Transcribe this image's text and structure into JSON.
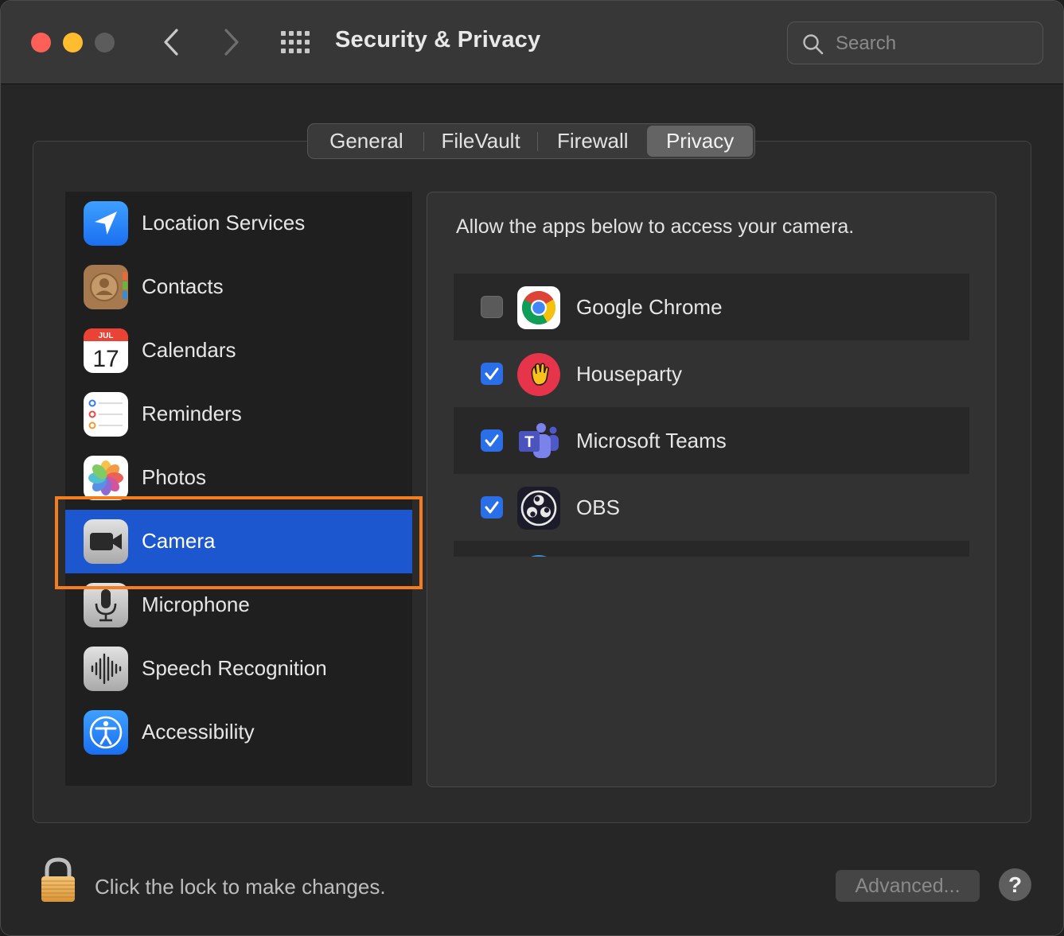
{
  "window": {
    "title": "Security & Privacy"
  },
  "search": {
    "placeholder": "Search"
  },
  "tabs": [
    {
      "label": "General"
    },
    {
      "label": "FileVault"
    },
    {
      "label": "Firewall"
    },
    {
      "label": "Privacy",
      "selected": true
    }
  ],
  "sidebar": {
    "items": [
      {
        "label": "Location Services",
        "icon": "location-arrow-icon"
      },
      {
        "label": "Contacts",
        "icon": "contacts-icon"
      },
      {
        "label": "Calendars",
        "icon": "calendar-icon",
        "month": "JUL",
        "day": "17"
      },
      {
        "label": "Reminders",
        "icon": "reminders-icon"
      },
      {
        "label": "Photos",
        "icon": "photos-icon"
      },
      {
        "label": "Camera",
        "icon": "camera-icon",
        "selected": true
      },
      {
        "label": "Microphone",
        "icon": "microphone-icon"
      },
      {
        "label": "Speech Recognition",
        "icon": "waveform-icon"
      },
      {
        "label": "Accessibility",
        "icon": "accessibility-icon"
      }
    ]
  },
  "panel": {
    "description": "Allow the apps below to access your camera.",
    "apps": [
      {
        "name": "Google Chrome",
        "checked": false,
        "icon": "chrome-icon"
      },
      {
        "name": "Houseparty",
        "checked": true,
        "icon": "houseparty-icon"
      },
      {
        "name": "Microsoft Teams",
        "checked": true,
        "icon": "teams-icon",
        "icon_letter": "T"
      },
      {
        "name": "OBS",
        "checked": true,
        "icon": "obs-icon"
      }
    ]
  },
  "footer": {
    "lock_text": "Click the lock to make changes.",
    "advanced_label": "Advanced...",
    "help_label": "?"
  },
  "colors": {
    "selection": "#1c57cf",
    "highlight_border": "#f47d20",
    "checkbox_checked": "#2a6ee8"
  }
}
